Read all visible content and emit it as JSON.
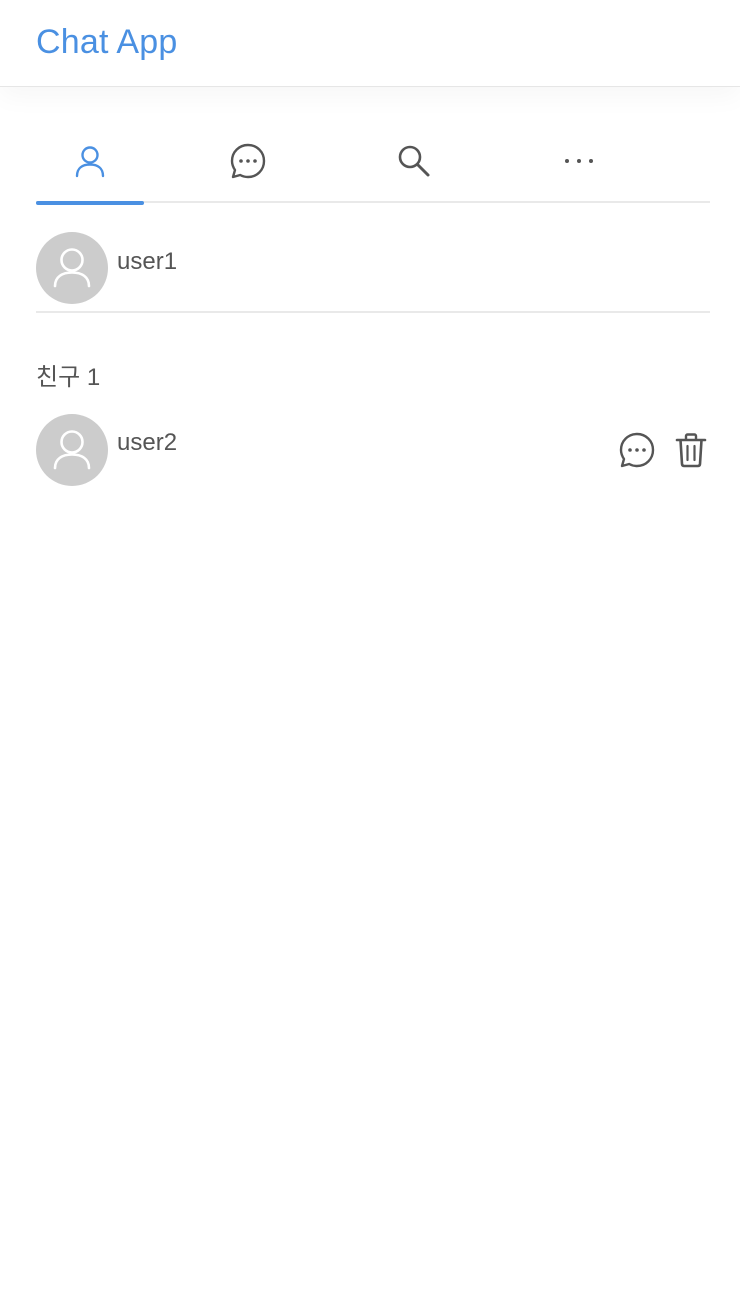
{
  "header": {
    "title": "Chat App",
    "accent_color": "#4a90e2"
  },
  "tabs": [
    {
      "icon": "person-icon",
      "active": true
    },
    {
      "icon": "chat-bubble-icon",
      "active": false
    },
    {
      "icon": "search-icon",
      "active": false
    },
    {
      "icon": "more-icon",
      "active": false
    }
  ],
  "profile": {
    "username": "user1",
    "avatar_icon": "person-icon"
  },
  "friends": {
    "section_label": "친구 1",
    "items": [
      {
        "username": "user2",
        "avatar_icon": "person-icon",
        "actions": [
          "chat-bubble-icon",
          "trash-icon"
        ]
      }
    ]
  }
}
